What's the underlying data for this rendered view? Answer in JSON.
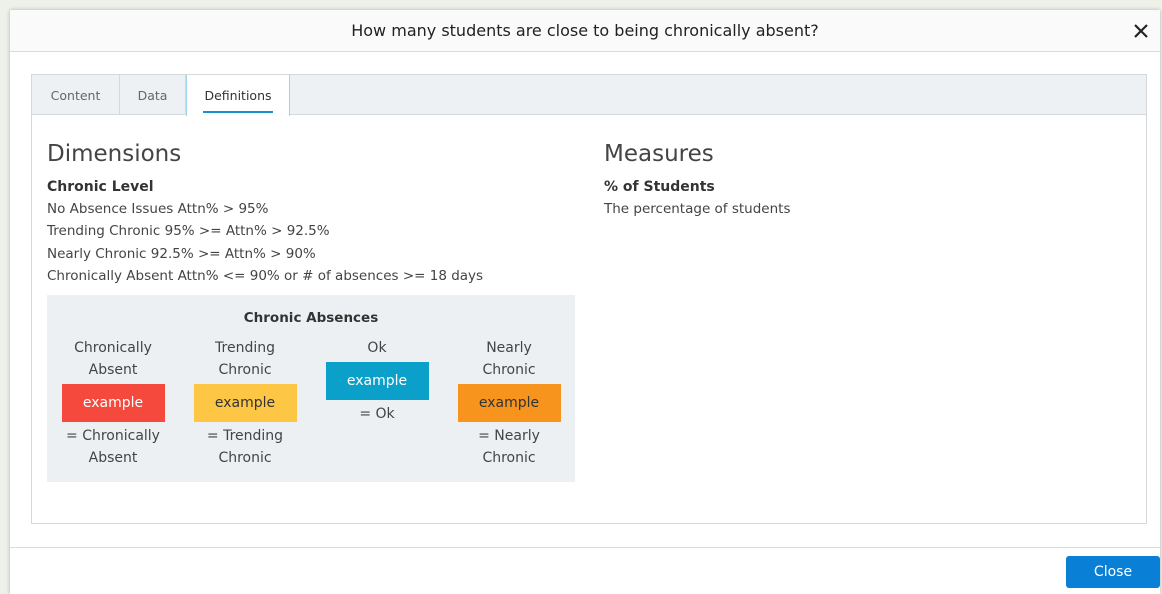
{
  "dialog": {
    "title": "How many students are close to being chronically absent?",
    "close_label": "Close"
  },
  "tabs": [
    {
      "label": "Content"
    },
    {
      "label": "Data"
    },
    {
      "label": "Definitions",
      "active": true
    }
  ],
  "dimensions": {
    "heading": "Dimensions",
    "item_title": "Chronic Level",
    "lines": [
      "No Absence Issues Attn% > 95%",
      "Trending Chronic 95% >= Attn% > 92.5%",
      "Nearly Chronic 92.5% >= Attn% > 90%",
      "Chronically Absent Attn% <= 90% or # of absences >= 18 days"
    ]
  },
  "legend": {
    "title": "Chronic Absences",
    "items": [
      {
        "top": "Chronically Absent",
        "swatch": "example",
        "bottom": "= Chronically Absent",
        "color": "#f4493c",
        "text_color": "#ffffff"
      },
      {
        "top": "Trending Chronic",
        "swatch": "example",
        "bottom": "= Trending Chronic",
        "color": "#fdc745",
        "text_color": "#333333"
      },
      {
        "top": "Ok",
        "swatch": "example",
        "bottom": "= Ok",
        "color": "#0aa0c9",
        "text_color": "#ffffff"
      },
      {
        "top": "Nearly Chronic",
        "swatch": "example",
        "bottom": "= Nearly Chronic",
        "color": "#f7941d",
        "text_color": "#333333"
      }
    ]
  },
  "measures": {
    "heading": "Measures",
    "item_title": "% of Students",
    "description": "The percentage of students"
  }
}
